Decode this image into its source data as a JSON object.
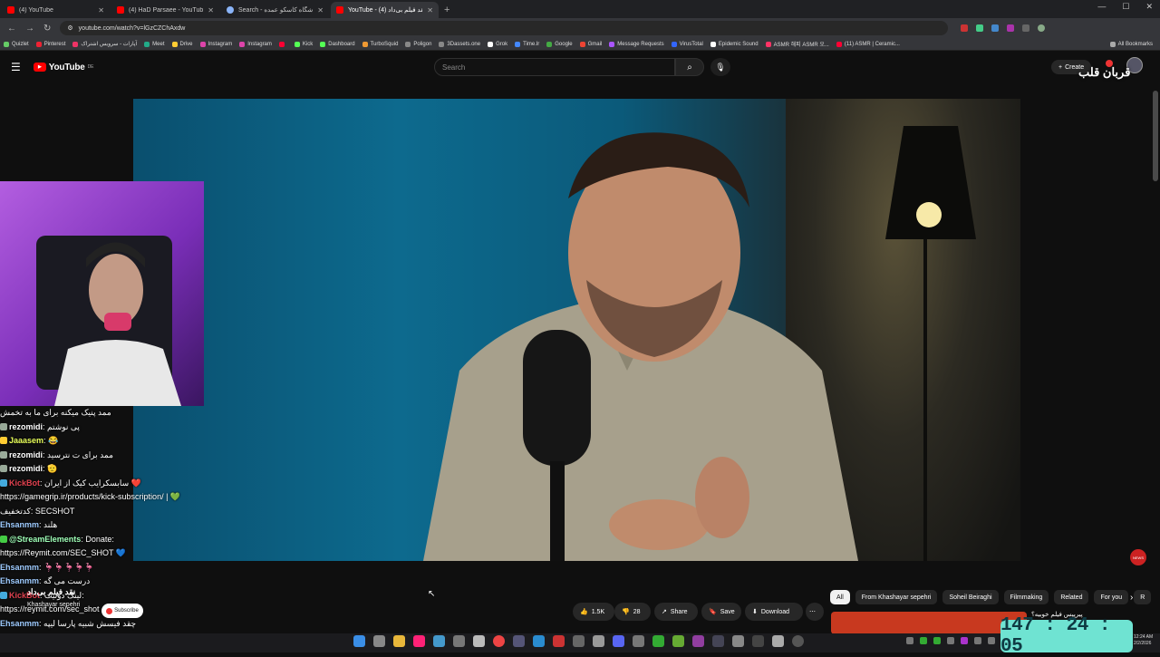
{
  "browser": {
    "tabs": [
      {
        "title": "(4) YouTube",
        "active": false
      },
      {
        "title": "(4) HaD Parsaee - YouTube",
        "active": false
      },
      {
        "title": "Search - فروشگاه کاسکو عمده",
        "active": false
      },
      {
        "title": "YouTube - نقد فیلم بی‌داد (4)",
        "active": true
      }
    ],
    "url": "youtube.com/watch?v=lGzCZChAxdw",
    "bookmarks": [
      "Quizlet",
      "Pinterest",
      "آپارات - سرویس اشتراک",
      "Meet",
      "Drive",
      "Instagram",
      "Instagram",
      "",
      "Kick",
      "Dashboard",
      "TurboSquid",
      "Poligon",
      "3Dassets.one",
      "Grok",
      "Time.lr",
      "Google",
      "Gmail",
      "Message Requests",
      "VirusTotal",
      "Epidemic Sound",
      "ASMR 해피 ASMR 오...",
      "(11) ASMR | Ceramic..."
    ],
    "all_bookmarks": "All Bookmarks"
  },
  "youtube": {
    "logo": "YouTube",
    "region": "DE",
    "search_placeholder": "Search",
    "create": "Create",
    "overlay_title": "قربان قلب",
    "actions": {
      "likes": "1.5K",
      "dislikes": "28",
      "share": "Share",
      "save": "Save",
      "download": "Download"
    },
    "chips": [
      "All",
      "From Khashayar sepehri",
      "Soheil Beiraghi",
      "Filmmaking",
      "Related",
      "For you",
      "R"
    ],
    "suggestion_title": "پیرپیس فیلم خوبیه؟",
    "video_title_overlay": "نقد فیلم بی‌داد",
    "channel": "Khashayar sepehri",
    "subscribe": "Subscribe"
  },
  "chat": [
    {
      "user": "",
      "text": "ممد پنیک میکنه برای ما به تخمش"
    },
    {
      "user": "rezomidi",
      "text": "پی نوشتم"
    },
    {
      "user": "Jaaasem",
      "text": "😂"
    },
    {
      "user": "rezomidi",
      "text": "ممد برای ت نترسید"
    },
    {
      "user": "rezomidi",
      "text": "🫡"
    },
    {
      "user": "KickBot",
      "text": "سابسکرایب کیک از ایران ❤️"
    },
    {
      "user": "",
      "text": "https://gamegrip.ir/products/kick-subscription/ | 💚"
    },
    {
      "user": "",
      "text": "کدتخفیف: SECSHOT"
    },
    {
      "user": "Ehsanmm",
      "text": "هلند"
    },
    {
      "user": "@StreamElements",
      "text": "Donate:"
    },
    {
      "user": "",
      "text": "https://Reymit.com/SEC_SHOT 💙"
    },
    {
      "user": "Ehsanmm",
      "text": "🦩🦩🦩🦩🦩"
    },
    {
      "user": "Ehsanmm",
      "text": "درست می گه"
    },
    {
      "user": "KickBot",
      "text": "لینک دونیت:"
    },
    {
      "user": "",
      "text": "https://reymit.com/sec_shot"
    },
    {
      "user": "Ehsanmm",
      "text": "چقد فیسش شبیه پارسا لیپه"
    }
  ],
  "timer": "147 : 24 : 05",
  "clock": {
    "time": "12:24 AM",
    "date": "2/2/2026"
  },
  "colors": {
    "timer_bg": "#6fe3d2",
    "accent": "#ff0000",
    "chat_mod": "#9effb7",
    "kickbot": "#e0414f"
  }
}
